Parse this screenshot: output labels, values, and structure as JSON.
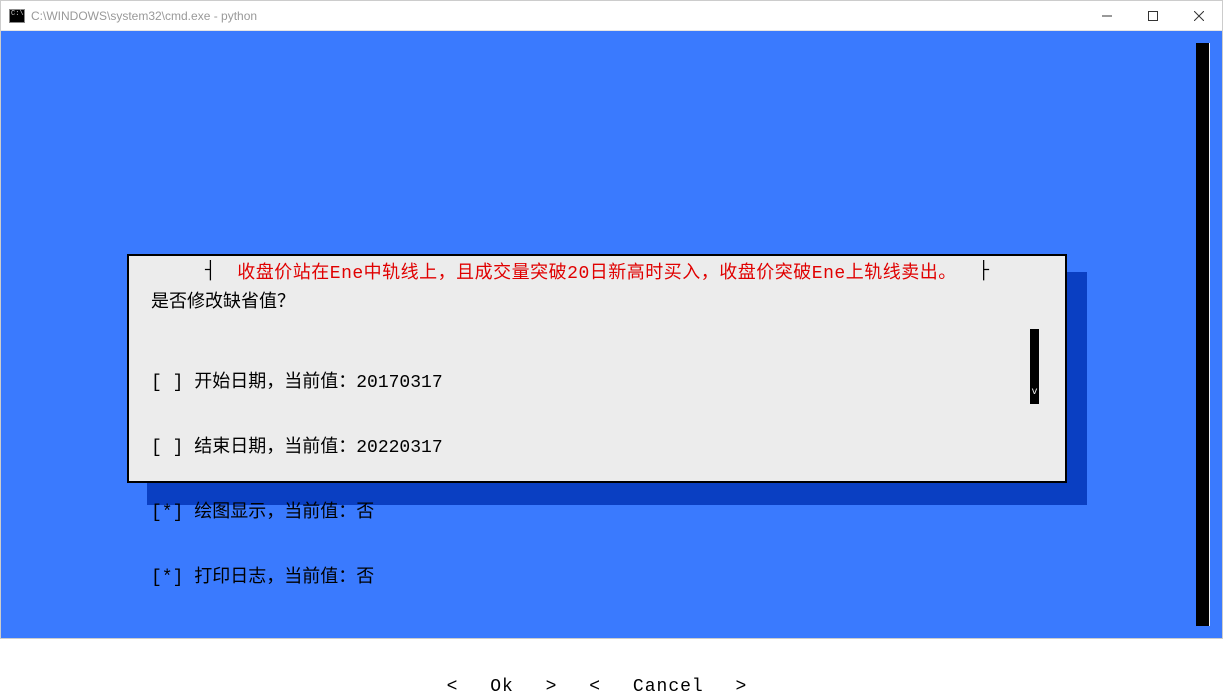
{
  "window": {
    "title": "C:\\WINDOWS\\system32\\cmd.exe - python"
  },
  "dialog": {
    "title": "收盘价站在Ene中轨线上，且成交量突破20日新高时买入，收盘价突破Ene上轨线卖出。",
    "prompt": "是否修改缺省值？",
    "options": [
      {
        "mark": "[ ]",
        "label": "开始日期，当前值：",
        "value": "20170317"
      },
      {
        "mark": "[ ]",
        "label": "结束日期，当前值：",
        "value": "20220317"
      },
      {
        "mark": "[*]",
        "label": "绘图显示，当前值：",
        "value": "否"
      },
      {
        "mark": "[*]",
        "label": "打印日志，当前值：",
        "value": "否"
      }
    ],
    "side_handle": "v",
    "buttons": {
      "ok": "Ok",
      "cancel": "Cancel"
    }
  }
}
